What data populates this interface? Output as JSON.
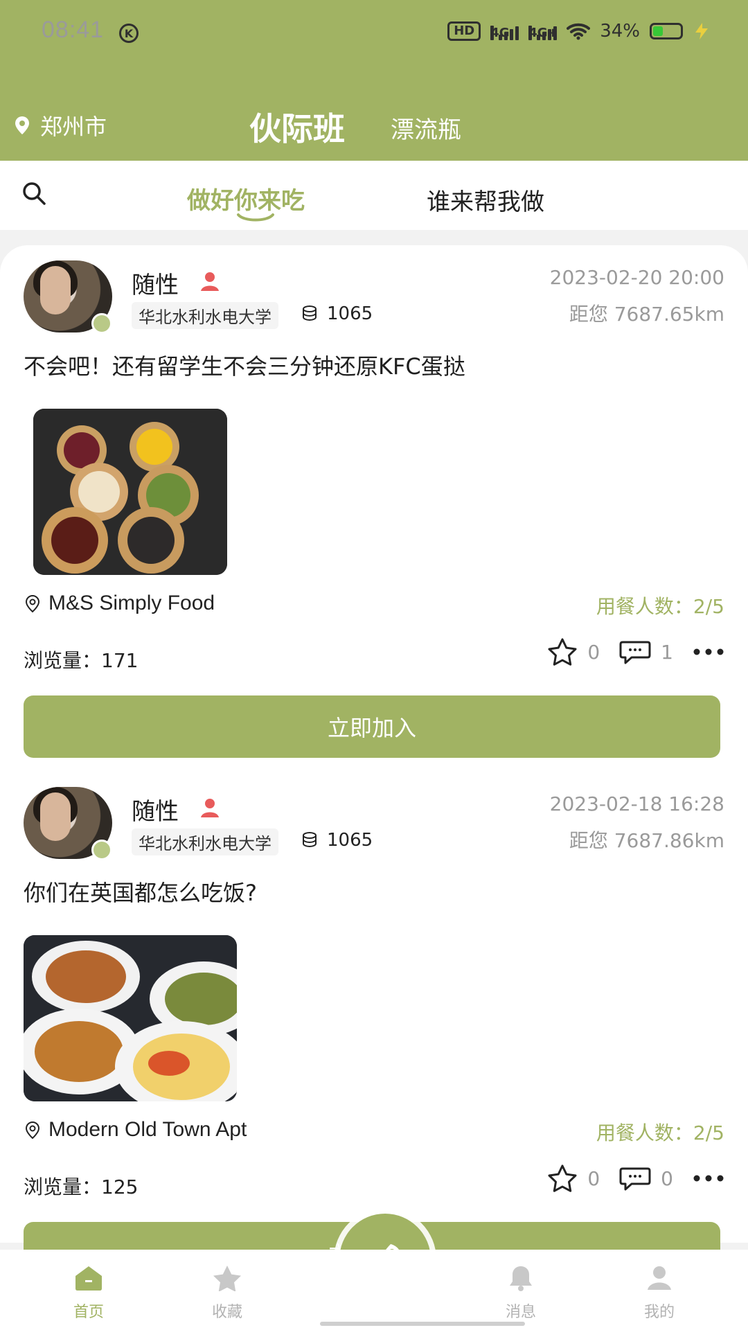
{
  "status_bar": {
    "time": "08:41",
    "k_label": "K",
    "hd_label": "HD",
    "network_1": "4G",
    "network_2": "4G+",
    "battery_percent": "34%"
  },
  "header": {
    "city": "郑州市",
    "brand": "伙际班",
    "drift_tab": "漂流瓶"
  },
  "top_tabs": {
    "active": "做好你来吃",
    "inactive": "谁来帮我做"
  },
  "posts": [
    {
      "username": "随性",
      "school": "华北水利水电大学",
      "points": "1065",
      "timestamp": "2023-02-20 20:00",
      "distance": "距您 7687.65km",
      "content": "不会吧！还有留学生不会三分钟还原KFC蛋挞",
      "location": "M&S Simply Food",
      "diners": "用餐人数：2/5",
      "views": "浏览量：171",
      "stars": "0",
      "comments": "1",
      "join_label": "立即加入"
    },
    {
      "username": "随性",
      "school": "华北水利水电大学",
      "points": "1065",
      "timestamp": "2023-02-18 16:28",
      "distance": "距您 7687.86km",
      "content": "你们在英国都怎么吃饭?",
      "location": "Modern Old Town Apt",
      "diners": "用餐人数：2/5",
      "views": "浏览量：125",
      "stars": "0",
      "comments": "0",
      "join_label": "立即加入"
    }
  ],
  "bottom_nav": {
    "home": "首页",
    "favorites": "收藏",
    "messages": "消息",
    "mine": "我的"
  },
  "colors": {
    "brand_green": "#A1B363",
    "muted_text": "#9A9A9A"
  },
  "icons": {
    "location": "map-pin-icon",
    "search": "search-icon",
    "coins": "coins-icon",
    "star": "star-icon",
    "comment": "comment-icon",
    "more": "more-icon",
    "rocket": "rocket-icon"
  }
}
